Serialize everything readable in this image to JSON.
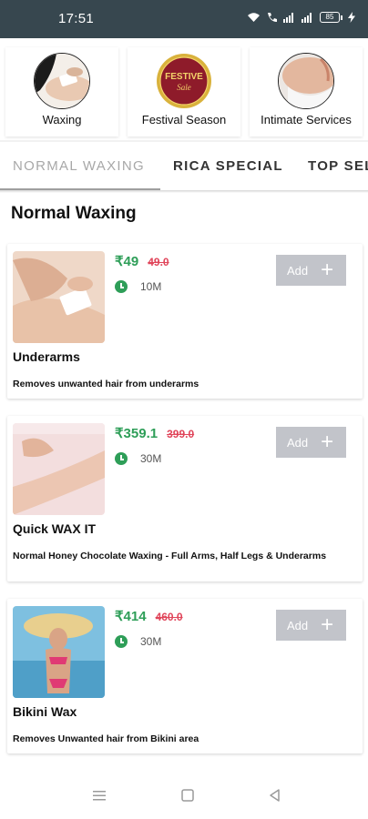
{
  "status_bar": {
    "time": "17:51",
    "battery": "85"
  },
  "categories": [
    {
      "label": "Waxing",
      "icon": "waxing-photo"
    },
    {
      "label": "Festival Season",
      "icon": "festive-sale-badge"
    },
    {
      "label": "Intimate Services",
      "icon": "intimate-services-photo"
    }
  ],
  "festive_badge": {
    "line1": "FESTIVE",
    "line2": "Sale"
  },
  "tabs": [
    {
      "label": "NORMAL WAXING",
      "active": true
    },
    {
      "label": "RICA SPECIAL",
      "active": false
    },
    {
      "label": "TOP SEL",
      "active": false
    }
  ],
  "section": {
    "title": "Normal Waxing"
  },
  "services": [
    {
      "price": "₹49",
      "old_price": "49.0",
      "duration": "10M",
      "add_label": "Add",
      "name": "Underarms",
      "description": "Removes unwanted hair from underarms"
    },
    {
      "price": "₹359.1",
      "old_price": "399.0",
      "duration": "30M",
      "add_label": "Add",
      "name": "Quick WAX IT",
      "description": "Normal Honey Chocolate Waxing - Full Arms, Half Legs & Underarms"
    },
    {
      "price": "₹414",
      "old_price": "460.0",
      "duration": "30M",
      "add_label": "Add",
      "name": "Bikini Wax",
      "description": "Removes Unwanted hair from Bikini area"
    }
  ],
  "colors": {
    "price_green": "#2e9e58",
    "old_price_red": "#e0455a",
    "add_button": "#c2c4ca",
    "status_bar": "#37474f"
  }
}
